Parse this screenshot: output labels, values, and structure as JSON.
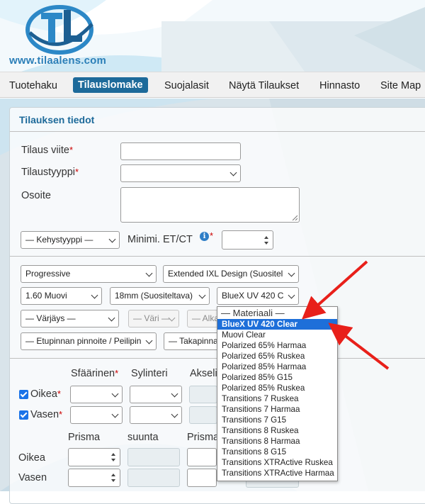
{
  "site": {
    "url": "www.tilaalens.com",
    "logo_letters": "TL"
  },
  "nav": {
    "items": [
      {
        "label": "Tuotehaku",
        "active": false
      },
      {
        "label": "Tilauslomake",
        "active": true
      },
      {
        "label": "Suojalasit",
        "active": false
      },
      {
        "label": "Näytä Tilaukset",
        "active": false
      },
      {
        "label": "Hinnasto",
        "active": false
      },
      {
        "label": "Site Map",
        "active": false
      }
    ]
  },
  "form": {
    "title": "Tilauksen tiedot",
    "required_mark": "*",
    "fields": {
      "tilaus_viite": {
        "label": "Tilaus viite",
        "value": ""
      },
      "tilaustyyppi": {
        "label": "Tilaustyyppi",
        "value": ""
      },
      "osoite": {
        "label": "Osoite",
        "value": ""
      },
      "kehystyyppi": {
        "value": "— Kehystyyppi —"
      },
      "minimi": {
        "label": "Minimi. ET/CT",
        "info_icon": "info-icon",
        "value": ""
      }
    },
    "lens": {
      "type": "Progressive",
      "design": "Extended IXL Design (Suositel",
      "index": "1.60 Muovi",
      "length": "18mm (Suositeltava)",
      "material_selected": "BlueX UV 420 C",
      "tint": "— Värjäys —",
      "color": "— Väri —",
      "alka": "— Alka",
      "front_coating": "— Etupinnan pinnoite / Peilipin",
      "back_coating": "— Takapinna"
    },
    "prescription": {
      "headers": {
        "sphere": "Sfäärinen",
        "cylinder": "Sylinteri",
        "axis": "Akseli"
      },
      "rows": [
        {
          "label": "Oikea",
          "checked": true
        },
        {
          "label": "Vasen",
          "checked": true
        }
      ],
      "prism_headers": {
        "prism1": "Prisma",
        "direction": "suunta",
        "prism2": "Prisma"
      },
      "prism_rows": [
        {
          "label": "Oikea"
        },
        {
          "label": "Vasen"
        }
      ]
    }
  },
  "material_dropdown": {
    "header": "— Materiaali —",
    "selected_index": 0,
    "options": [
      "BlueX UV 420 Clear",
      "Muovi Clear",
      "Polarized 65% Harmaa",
      "Polarized 65% Ruskea",
      "Polarized 85% Harmaa",
      "Polarized 85% G15",
      "Polarized 85% Ruskea",
      "Transitions 7 Ruskea",
      "Transitions 7 Harmaa",
      "Transitions 7 G15",
      "Transitions 8 Ruskea",
      "Transitions 8 Harmaa",
      "Transitions 8 G15",
      "Transitions XTRActive Ruskea",
      "Transitions XTRActive Harmaa"
    ]
  },
  "colors": {
    "brand": "#1d6a9a",
    "link": "#2c7fb8",
    "highlight": "#1e6fd9",
    "annotation_arrow": "#e8201a"
  }
}
